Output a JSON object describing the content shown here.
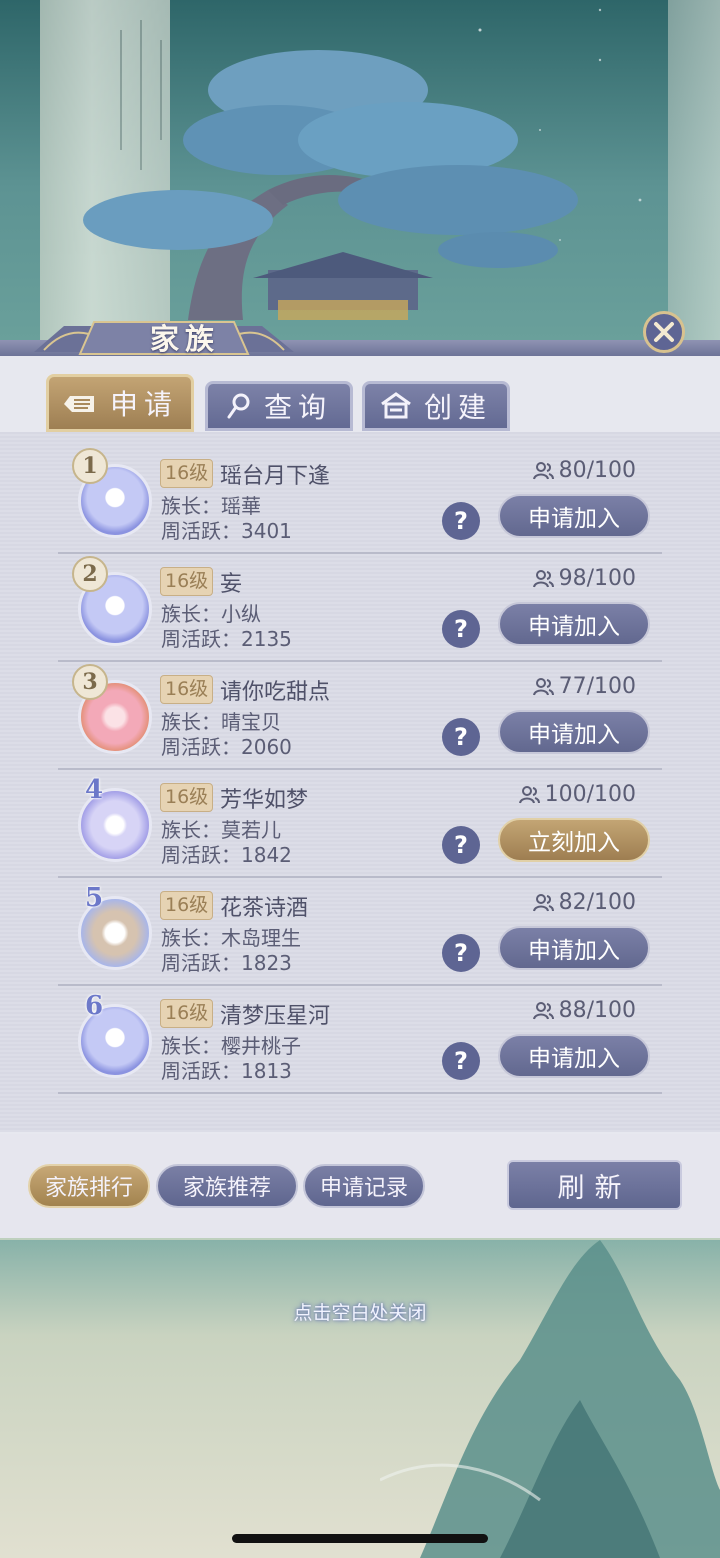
{
  "header": {
    "title": "家族"
  },
  "tabs": [
    {
      "label": "申请",
      "icon": "hand-wave-icon",
      "active": true
    },
    {
      "label": "查询",
      "icon": "magnifier-icon",
      "active": false
    },
    {
      "label": "创建",
      "icon": "house-icon",
      "active": false
    }
  ],
  "families": [
    {
      "rank": "1",
      "level": "16级",
      "name": "瑶台月下逢",
      "leader": "族长：瑶華",
      "activity": "周活跃：3401",
      "members": "80/100",
      "action": "申请加入",
      "avatar": "white-deer"
    },
    {
      "rank": "2",
      "level": "16级",
      "name": "妄",
      "leader": "族长：小纵",
      "activity": "周活跃：2135",
      "members": "98/100",
      "action": "申请加入",
      "avatar": "white-deer"
    },
    {
      "rank": "3",
      "level": "16级",
      "name": "请你吃甜点",
      "leader": "族长：晴宝贝",
      "activity": "周活跃：2060",
      "members": "77/100",
      "action": "申请加入",
      "avatar": "lotus"
    },
    {
      "rank": "4",
      "level": "16级",
      "name": "芳华如梦",
      "leader": "族长：莫若儿",
      "activity": "周活跃：1842",
      "members": "100/100",
      "action": "立刻加入",
      "avatar": "moon-rabbit"
    },
    {
      "rank": "5",
      "level": "16级",
      "name": "花茶诗酒",
      "leader": "族长：木岛理生",
      "activity": "周活跃：1823",
      "members": "82/100",
      "action": "申请加入",
      "avatar": "calico-cat"
    },
    {
      "rank": "6",
      "level": "16级",
      "name": "清梦压星河",
      "leader": "族长：樱井桃子",
      "activity": "周活跃：1813",
      "members": "88/100",
      "action": "申请加入",
      "avatar": "white-deer"
    }
  ],
  "bottom_tabs": [
    {
      "label": "家族排行",
      "active": true
    },
    {
      "label": "家族推荐",
      "active": false
    },
    {
      "label": "申请记录",
      "active": false
    }
  ],
  "refresh_label": "刷新",
  "close_hint": "点击空白处关闭",
  "colors": {
    "accent_gold": "#b3936a",
    "accent_purple": "#6a7199",
    "panel_bg": "#e7e8ef"
  }
}
